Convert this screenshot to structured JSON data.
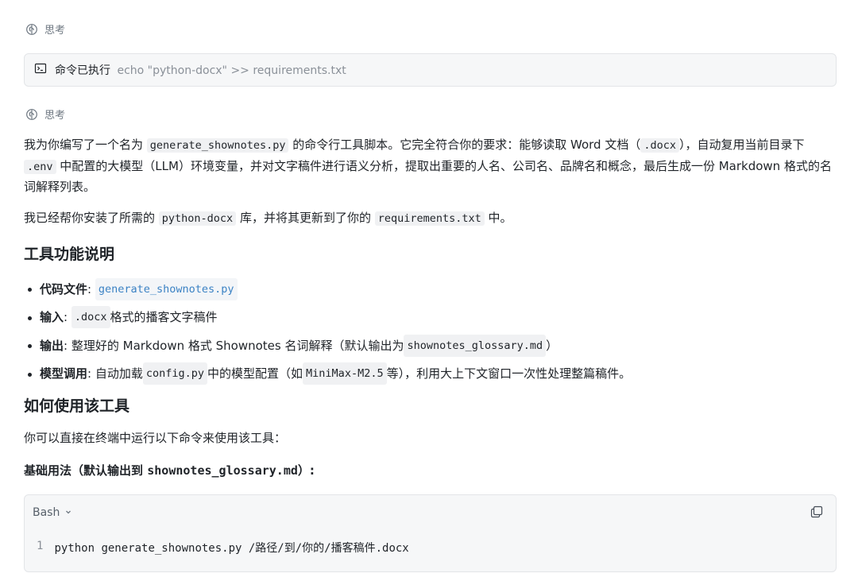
{
  "thinking": {
    "label": "思考"
  },
  "command_result": {
    "label": "命令已执行",
    "command": "echo \"python-docx\" >> requirements.txt"
  },
  "intro": {
    "p1_a": "我为你编写了一个名为 ",
    "p1_code1": "generate_shownotes.py",
    "p1_b": " 的命令行工具脚本。它完全符合你的要求：能够读取 Word 文档（",
    "p1_code2": ".docx",
    "p1_c": "），自动复用当前目录下 ",
    "p1_code3": ".env",
    "p1_d": " 中配置的大模型（LLM）环境变量，并对文字稿件进行语义分析，提取出重要的人名、公司名、品牌名和概念，最后生成一份 Markdown 格式的名词解释列表。",
    "p2_a": "我已经帮你安装了所需的 ",
    "p2_code1": "python-docx",
    "p2_b": " 库，并将其更新到了你的 ",
    "p2_code2": "requirements.txt",
    "p2_c": " 中。"
  },
  "section1": {
    "title": "工具功能说明",
    "items": [
      {
        "label": "代码文件",
        "sep": ": ",
        "code": "generate_shownotes.py",
        "rest": ""
      },
      {
        "label": "输入",
        "sep": ": ",
        "code": ".docx",
        "rest": " 格式的播客文字稿件"
      },
      {
        "label": "输出",
        "sep": ": ",
        "pre": "整理好的 Markdown 格式 Shownotes 名词解释（默认输出为 ",
        "code": "shownotes_glossary.md",
        "rest": "）"
      },
      {
        "label": "模型调用",
        "sep": ": ",
        "pre": "自动加载 ",
        "code": "config.py",
        "mid": " 中的模型配置（如 ",
        "code2": "MiniMax-M2.5",
        "rest": " 等），利用大上下文窗口一次性处理整篇稿件。"
      }
    ]
  },
  "section2": {
    "title": "如何使用该工具",
    "desc": "你可以直接在终端中运行以下命令来使用该工具：",
    "usage_label_a": "基础用法（默认输出到 ",
    "usage_label_code": "shownotes_glossary.md",
    "usage_label_b": "）:"
  },
  "code_block": {
    "language": "Bash",
    "lines": [
      {
        "no": "1",
        "text": "python generate_shownotes.py /路径/到/你的/播客稿件.docx"
      }
    ]
  }
}
